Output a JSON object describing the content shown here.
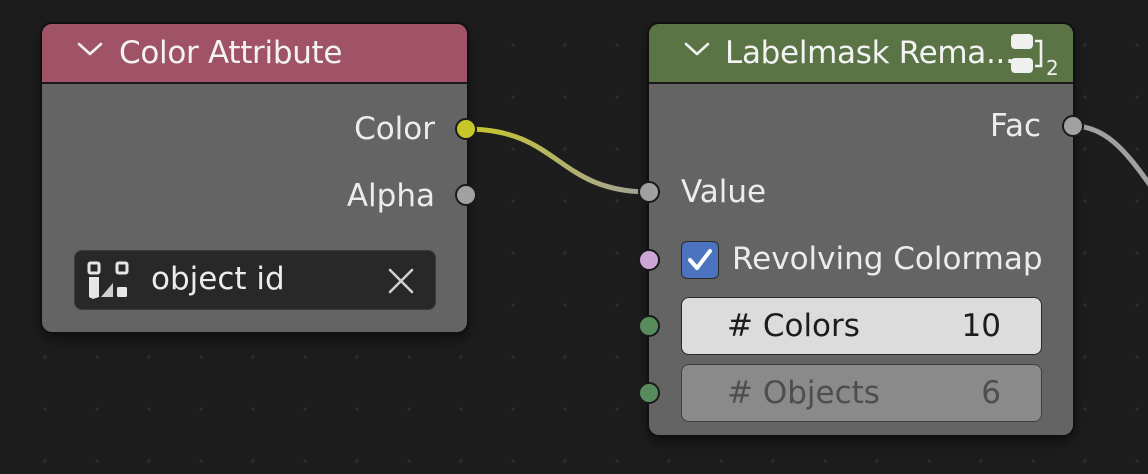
{
  "color_attribute_node": {
    "title": "Color Attribute",
    "header_color": "#a05266",
    "outputs": [
      {
        "label": "Color",
        "socket_color": "#c7c729"
      },
      {
        "label": "Alpha",
        "socket_color": "#a1a1a1"
      }
    ],
    "attribute_field": {
      "value": "object id",
      "icon": "vertex-color-attribute-icon",
      "clear_icon": "close-icon"
    }
  },
  "labelmask_node": {
    "title": "Labelmask Rema...",
    "header_color": "#5a7446",
    "group_icon": "node-group-icon",
    "group_users": "2",
    "outputs": [
      {
        "label": "Fac",
        "socket_color": "#a1a1a1"
      }
    ],
    "inputs": {
      "value": {
        "label": "Value",
        "socket_color": "#a1a1a1"
      },
      "revolving": {
        "label": "Revolving Colormap",
        "checked": true,
        "socket_color": "#cca6d6"
      },
      "colors": {
        "label": "# Colors",
        "value": "10",
        "socket_color": "#598c5c"
      },
      "objects": {
        "label": "# Objects",
        "value": "6",
        "socket_color": "#598c5c"
      }
    }
  }
}
